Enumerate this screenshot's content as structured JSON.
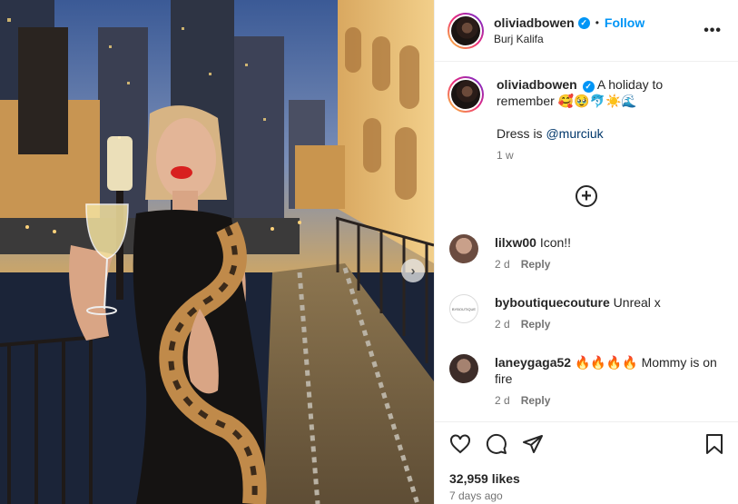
{
  "post": {
    "username": "oliviadbowen",
    "follow_label": "Follow",
    "dot": "•",
    "location": "Burj Kalifa",
    "more_label": "•••",
    "caption_text": "A holiday to remember 🥰🥹🐬☀️🌊",
    "caption_line2_prefix": "Dress is ",
    "caption_mention": "@murciuk",
    "caption_time": "1 w",
    "load_more_label": "+",
    "next_label": "›"
  },
  "comments": [
    {
      "username": "lilxw00",
      "text": "Icon!!",
      "time": "2 d",
      "reply": "Reply"
    },
    {
      "username": "byboutiquecouture",
      "text": "Unreal x",
      "time": "2 d",
      "reply": "Reply",
      "avatar_text": "BYBOUTIQUE"
    },
    {
      "username": "laneygaga52",
      "text": "🔥🔥🔥🔥 Mommy is on fire",
      "time": "2 d",
      "reply": "Reply"
    }
  ],
  "footer": {
    "likes": "32,959 likes",
    "posted": "7 days ago"
  },
  "icons": [
    "heart-icon",
    "comment-icon",
    "share-icon",
    "bookmark-icon",
    "chevron-right-icon",
    "plus-circle-icon",
    "more-icon",
    "verified-icon"
  ],
  "colors": {
    "accent": "#0095f6",
    "mention": "#00376b",
    "muted": "#737373"
  }
}
